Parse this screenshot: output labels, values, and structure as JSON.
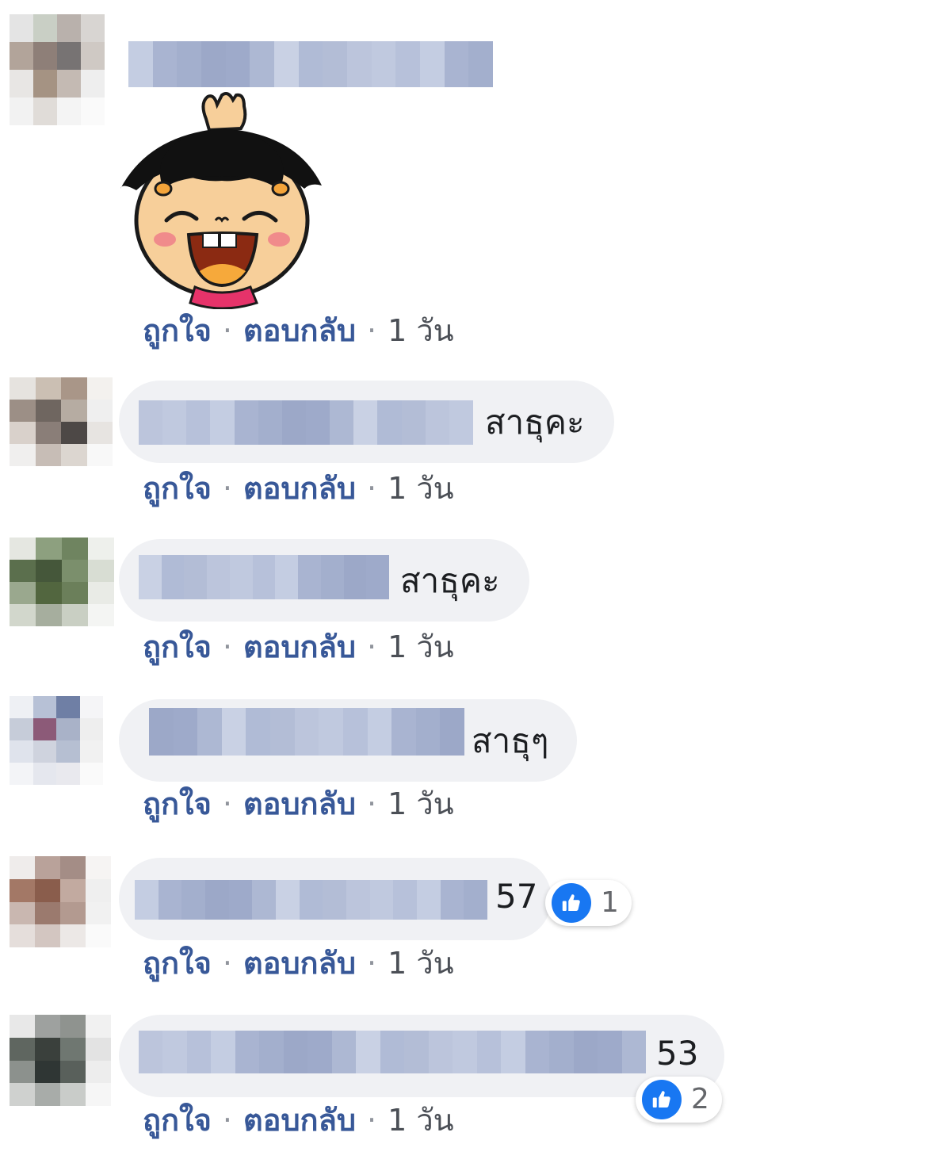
{
  "comments": [
    {
      "has_sticker": true,
      "sticker_name": "praying-girl-sticker",
      "text": "",
      "actions": {
        "like": "ถูกใจ",
        "reply": "ตอบกลับ",
        "time": "1 วัน"
      }
    },
    {
      "text": "สาธุคะ",
      "actions": {
        "like": "ถูกใจ",
        "reply": "ตอบกลับ",
        "time": "1 วัน"
      }
    },
    {
      "text": "สาธุคะ",
      "actions": {
        "like": "ถูกใจ",
        "reply": "ตอบกลับ",
        "time": "1 วัน"
      }
    },
    {
      "text": "สาธุๆ",
      "actions": {
        "like": "ถูกใจ",
        "reply": "ตอบกลับ",
        "time": "1 วัน"
      }
    },
    {
      "text": "57",
      "reaction": {
        "icon": "like-icon",
        "count": "1"
      },
      "actions": {
        "like": "ถูกใจ",
        "reply": "ตอบกลับ",
        "time": "1 วัน"
      }
    },
    {
      "text": "53",
      "reaction": {
        "icon": "like-icon",
        "count": "2"
      },
      "actions": {
        "like": "ถูกใจ",
        "reply": "ตอบกลับ",
        "time": "1 วัน"
      }
    }
  ],
  "separator": "·",
  "colors": {
    "link": "#385898",
    "bubble": "#f0f1f4",
    "text": "#1c1e21",
    "like_blue": "#1877f2",
    "blur_name": "#b3bdd6"
  }
}
